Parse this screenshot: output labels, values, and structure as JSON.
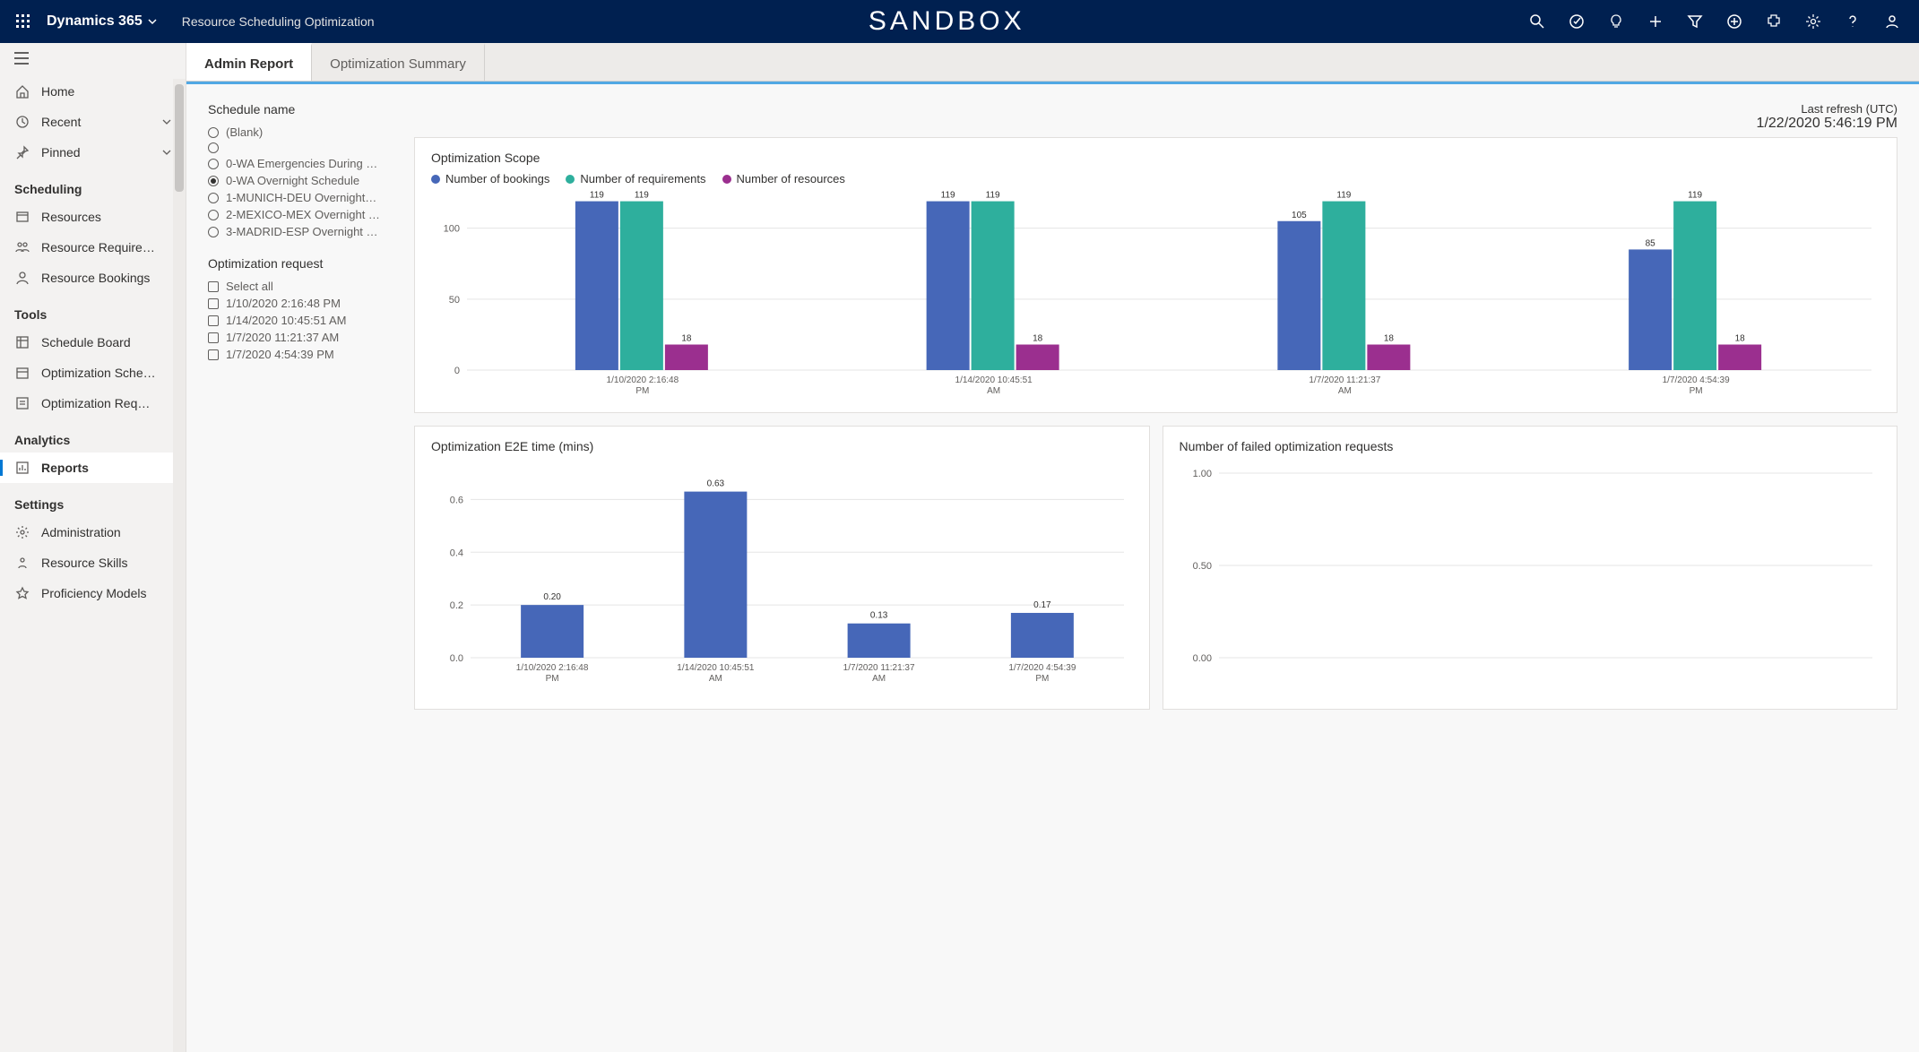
{
  "topbar": {
    "brand": "Dynamics 365",
    "app_title": "Resource Scheduling Optimization",
    "center": "SANDBOX"
  },
  "sidebar": {
    "home": "Home",
    "recent": "Recent",
    "pinned": "Pinned",
    "groups": {
      "scheduling": "Scheduling",
      "tools": "Tools",
      "analytics": "Analytics",
      "settings": "Settings"
    },
    "items": {
      "resources": "Resources",
      "resource_require": "Resource Require…",
      "resource_bookings": "Resource Bookings",
      "schedule_board": "Schedule Board",
      "optimization_sche": "Optimization Sche…",
      "optimization_req": "Optimization Req…",
      "reports": "Reports",
      "administration": "Administration",
      "resource_skills": "Resource Skills",
      "proficiency_models": "Proficiency Models"
    }
  },
  "tabs": {
    "admin_report": "Admin Report",
    "optimization_summary": "Optimization Summary"
  },
  "filters": {
    "schedule_name": {
      "title": "Schedule name",
      "items": [
        "(Blank)",
        "",
        "0-WA Emergencies During …",
        "0-WA Overnight Schedule",
        "1-MUNICH-DEU Overnight…",
        "2-MEXICO-MEX Overnight …",
        "3-MADRID-ESP Overnight …"
      ]
    },
    "optimization_request": {
      "title": "Optimization request",
      "items": [
        "Select all",
        "1/10/2020 2:16:48 PM",
        "1/14/2020 10:45:51 AM",
        "1/7/2020 11:21:37 AM",
        "1/7/2020 4:54:39 PM"
      ]
    }
  },
  "refresh": {
    "label": "Last refresh (UTC)",
    "time": "1/22/2020 5:46:19 PM"
  },
  "charts": {
    "scope": {
      "title": "Optimization Scope",
      "legend": [
        "Number of bookings",
        "Number of requirements",
        "Number of resources"
      ]
    },
    "e2e": {
      "title": "Optimization E2E time (mins)"
    },
    "failed": {
      "title": "Number of failed optimization requests"
    }
  },
  "chart_data": [
    {
      "type": "bar",
      "title": "Optimization Scope",
      "categories": [
        "1/10/2020 2:16:48 PM",
        "1/14/2020 10:45:51 AM",
        "1/7/2020 11:21:37 AM",
        "1/7/2020 4:54:39 PM"
      ],
      "series": [
        {
          "name": "Number of bookings",
          "color": "#4667b8",
          "values": [
            119,
            119,
            105,
            85
          ]
        },
        {
          "name": "Number of requirements",
          "color": "#2eaf9d",
          "values": [
            119,
            119,
            119,
            119
          ]
        },
        {
          "name": "Number of resources",
          "color": "#9b2f8f",
          "values": [
            18,
            18,
            18,
            18
          ]
        }
      ],
      "ylim": [
        0,
        120
      ],
      "yticks": [
        0,
        50,
        100
      ]
    },
    {
      "type": "bar",
      "title": "Optimization E2E time (mins)",
      "categories": [
        "1/10/2020 2:16:48 PM",
        "1/14/2020 10:45:51 AM",
        "1/7/2020 11:21:37 AM",
        "1/7/2020 4:54:39 PM"
      ],
      "series": [
        {
          "name": "E2E time",
          "color": "#4667b8",
          "values": [
            0.2,
            0.63,
            0.13,
            0.17
          ]
        }
      ],
      "ylim": [
        0,
        0.7
      ],
      "yticks": [
        0.0,
        0.2,
        0.4,
        0.6
      ]
    },
    {
      "type": "bar",
      "title": "Number of failed optimization requests",
      "categories": [],
      "series": [],
      "ylim": [
        0,
        1.0
      ],
      "yticks": [
        0.0,
        0.5,
        1.0
      ]
    }
  ]
}
